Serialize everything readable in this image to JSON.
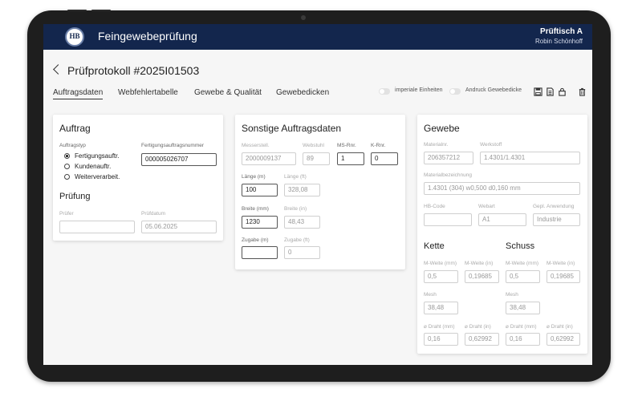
{
  "header": {
    "app_title": "Feingewebeprüfung",
    "logo_text": "HB",
    "station": "Prüftisch A",
    "user": "Robin Schönhoff"
  },
  "page": {
    "title": "Prüfprotokoll #2025I01503"
  },
  "tabs": [
    {
      "label": "Auftragsdaten",
      "active": true
    },
    {
      "label": "Webfehlertabelle",
      "active": false
    },
    {
      "label": "Gewebe & Qualität",
      "active": false
    },
    {
      "label": "Gewebedicken",
      "active": false
    }
  ],
  "toolbar": {
    "toggle_imperial": "imperiale Einheiten",
    "toggle_print": "Andruck Gewebedicke",
    "icons": [
      "save-icon",
      "export-icon",
      "lock-icon",
      "trash-icon"
    ]
  },
  "auftrag": {
    "title": "Auftrag",
    "type_label": "Auftragstyp",
    "options": [
      "Fertigungsauftr.",
      "Kundenauftr.",
      "Weiterverarbeit."
    ],
    "selected": 0,
    "order_no_label": "Fertigungsauftragsnummer",
    "order_no": "000005026707",
    "pruefung_title": "Prüfung",
    "pruefer_label": "Prüfer",
    "pruefer_value": "",
    "datum_label": "Prüfdatum",
    "datum_value": "05.06.2025"
  },
  "sonstige": {
    "title": "Sonstige Auftragsdaten",
    "messerstell_label": "Messerstell.",
    "messerstell": "2000009137",
    "webstuhl_label": "Webstuhl",
    "webstuhl": "89",
    "ms_label": "MS-Rnr.",
    "ms": "1",
    "k_label": "K-Rnr.",
    "k": "0",
    "laenge_m_label": "Länge (m)",
    "laenge_m": "100",
    "laenge_ft_label": "Länge (ft)",
    "laenge_ft": "328,08",
    "breite_mm_label": "Breite (mm)",
    "breite_mm": "1230",
    "breite_in_label": "Breite (in)",
    "breite_in": "48,43",
    "zugabe_m_label": "Zugabe (m)",
    "zugabe_m": "",
    "zugabe_ft_label": "Zugabe (ft)",
    "zugabe_ft": "0"
  },
  "gewebe": {
    "title": "Gewebe",
    "materialnr_label": "Materialnr.",
    "materialnr": "206357212",
    "werkstoff_label": "Werkstoff",
    "werkstoff": "1.4301/1.4301",
    "bez_label": "Materialbezeichnung",
    "bez": "1.4301 (304) w0,500 d0,160 mm",
    "hb_label": "HB-Code",
    "hb": "",
    "webart_label": "Webart",
    "webart": "A1",
    "anw_label": "Gepl. Anwendung",
    "anw": "Industrie",
    "kette": {
      "title": "Kette",
      "mw_mm_label": "M-Weite (mm)",
      "mw_mm": "0,5",
      "mw_in_label": "M-Weite (in)",
      "mw_in": "0,19685",
      "mesh_label": "Mesh",
      "mesh": "38,48",
      "d_mm_label": "⌀ Draht (mm)",
      "d_mm": "0,16",
      "d_in_label": "⌀ Draht (in)",
      "d_in": "0,62992"
    },
    "schuss": {
      "title": "Schuss",
      "mw_mm_label": "M-Weite (mm)",
      "mw_mm": "0,5",
      "mw_in_label": "M-Weite (in)",
      "mw_in": "0,19685",
      "mesh_label": "Mesh",
      "mesh": "38,48",
      "d_mm_label": "⌀ Draht (mm)",
      "d_mm": "0,16",
      "d_in_label": "⌀ Draht (in)",
      "d_in": "0,62992"
    }
  },
  "colors": {
    "header_bg": "#13264d",
    "screen_bg": "#f6f6f6",
    "frame": "#1e1e1e"
  }
}
